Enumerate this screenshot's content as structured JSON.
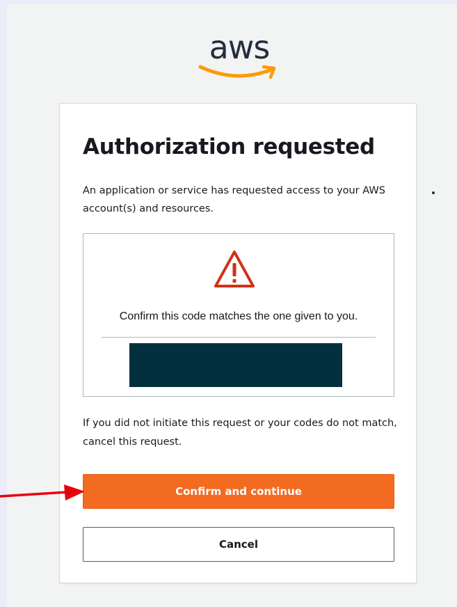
{
  "logo": {
    "text": "aws",
    "icon": "aws-smile-icon"
  },
  "card": {
    "title": "Authorization requested",
    "description": "An application or service has requested access to your AWS account(s) and resources.",
    "code_box": {
      "icon": "warning-icon",
      "instruction": "Confirm this code matches the one given to you.",
      "code_redacted": true
    },
    "note": "If you did not initiate this request or your codes do not match, cancel this request.",
    "confirm_button": "Confirm and continue",
    "cancel_button": "Cancel"
  },
  "annotation": {
    "icon": "red-arrow-icon"
  },
  "colors": {
    "primary_button": "#f26b21",
    "warning": "#d13212",
    "logo_text": "#232f3e",
    "logo_smile": "#ff9900",
    "redaction": "#02303f",
    "page_background": "#f2f3f3"
  }
}
